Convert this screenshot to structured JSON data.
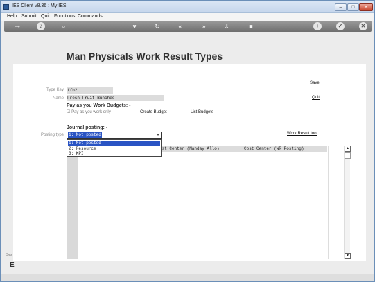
{
  "window": {
    "title": "IES Client v8.36 : My IES",
    "minimize": "–",
    "maximize": "□",
    "close": "✕"
  },
  "menu": [
    "Help",
    "Submit",
    "Quit",
    "Functions",
    "Commands"
  ],
  "toolbar_icons": [
    "key-icon",
    "help-icon",
    "search-icon",
    "heart-icon",
    "refresh-icon",
    "rewind-icon",
    "fast-forward-icon",
    "import-icon",
    "stop-icon",
    "plus-icon",
    "check-icon",
    "close-icon"
  ],
  "page": {
    "title": "Man Physicals Work Result Types",
    "type_key_label": "Type Key",
    "type_key_value": "ffb2",
    "name_label": "Name",
    "name_value": "Fresh Fruit Bunches",
    "save": "Save",
    "quit": "Quit",
    "pay_heading": "Pay as you Work Budgets: -",
    "pay_checkbox_label": "Pay as you work only",
    "create_budget": "Create Budget",
    "list_budgets": "List Budgets",
    "journal_heading": "Journal posting: -",
    "posting_type_label": "Posting type",
    "posting_type_value": "1: Not posted",
    "work_result_tool": "Work Result tool"
  },
  "dropdown_options": [
    "1: Not posted",
    "2: Resource",
    "3: KPI"
  ],
  "grid": {
    "col1": "ost Center (Manday Allo)",
    "col2": "Cost Center (WR Posting)"
  },
  "side": {
    "frag1": "Ses",
    "frag2": "E"
  }
}
